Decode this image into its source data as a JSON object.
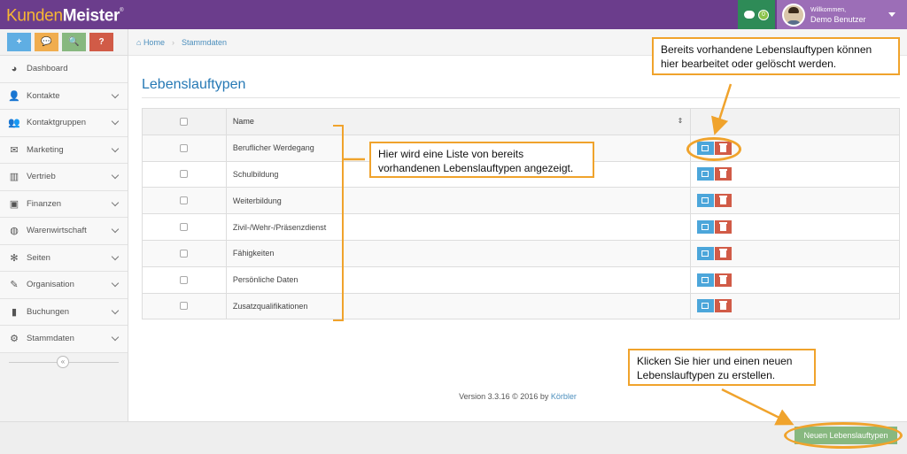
{
  "app": {
    "logo_part1": "Kunden",
    "logo_part2": "Meister",
    "logo_mark": "®"
  },
  "topbar": {
    "messages_count": "0",
    "welcome": "Willkommen,",
    "user_name": "Demo Benutzer"
  },
  "shortcuts": [
    {
      "label": "+",
      "color": "#5faee3"
    },
    {
      "label": "💬",
      "color": "#f0ad4e"
    },
    {
      "label": "🔍",
      "color": "#87b87f"
    },
    {
      "label": "?",
      "color": "#d15b47"
    }
  ],
  "sidebar": {
    "items": [
      {
        "label": "Dashboard",
        "icon": "dashboard-icon",
        "glyph": "◕"
      },
      {
        "label": "Kontakte",
        "icon": "user-icon",
        "glyph": "👤"
      },
      {
        "label": "Kontaktgruppen",
        "icon": "users-icon",
        "glyph": "👥"
      },
      {
        "label": "Marketing",
        "icon": "envelope-icon",
        "glyph": "✉"
      },
      {
        "label": "Vertrieb",
        "icon": "bar-chart-icon",
        "glyph": "▥"
      },
      {
        "label": "Finanzen",
        "icon": "money-icon",
        "glyph": "▣"
      },
      {
        "label": "Warenwirtschaft",
        "icon": "globe-icon",
        "glyph": "◍"
      },
      {
        "label": "Seiten",
        "icon": "leaf-icon",
        "glyph": "✻"
      },
      {
        "label": "Organisation",
        "icon": "edit-icon",
        "glyph": "✎"
      },
      {
        "label": "Buchungen",
        "icon": "bookmark-icon",
        "glyph": "▮"
      },
      {
        "label": "Stammdaten",
        "icon": "cogs-icon",
        "glyph": "⚙"
      }
    ],
    "collapse_label": "«"
  },
  "breadcrumb": {
    "home": "Home",
    "separator": "›",
    "current": "Stammdaten"
  },
  "page": {
    "title": "Lebenslauftypen"
  },
  "table": {
    "header_name": "Name",
    "sort_icon": "⇕",
    "rows": [
      "Beruflicher Werdegang",
      "Schulbildung",
      "Weiterbildung",
      "Zivil-/Wehr-/Präsenzdienst",
      "Fähigkeiten",
      "Persönliche Daten",
      "Zusatzqualifikationen"
    ]
  },
  "footer": {
    "version_text": "Version 3.3.16 © 2016 by",
    "link": "Körbler"
  },
  "new_button": {
    "label": "Neuen Lebenslauftypen"
  },
  "annotations": {
    "top_right": "Bereits vorhandene Lebenslauftypen können hier bearbeitet oder gelöscht werden.",
    "list": "Hier wird eine Liste von bereits vorhandenen Lebenslauftypen angezeigt.",
    "new": "Klicken Sie hier und einen neuen Lebenslauftypen zu erstellen."
  },
  "colors": {
    "topbar": "#6b3d8c",
    "accent": "#f0a32c",
    "edit": "#4ca6da",
    "delete": "#d15b47",
    "new_button": "#87b87f"
  }
}
